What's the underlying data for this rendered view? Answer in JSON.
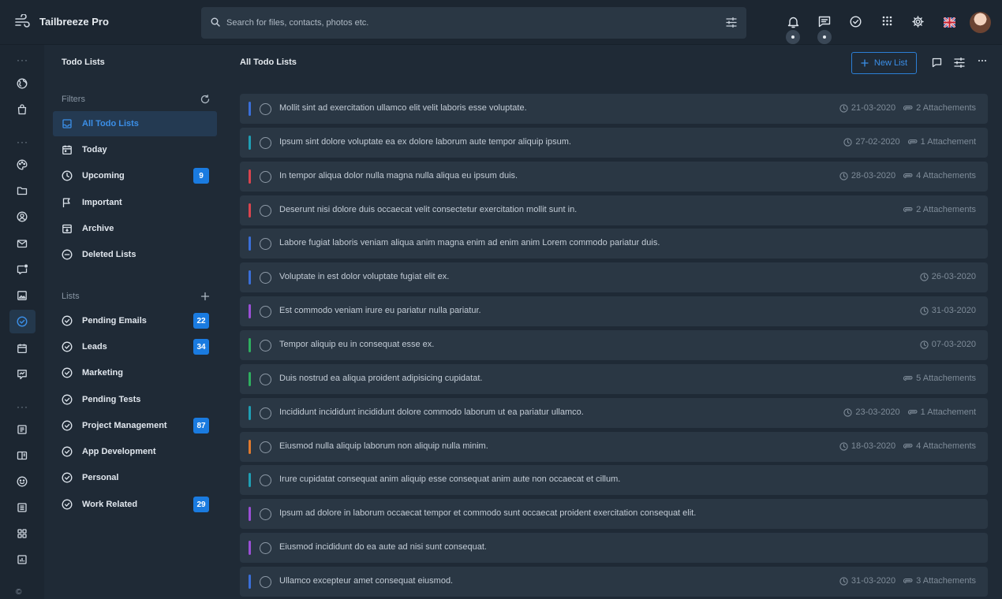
{
  "app": {
    "name": "Tailbreeze Pro"
  },
  "search": {
    "placeholder": "Search for files, contacts, photos etc."
  },
  "sidebar": {
    "title": "Todo Lists",
    "filters_label": "Filters",
    "lists_label": "Lists",
    "filters": [
      {
        "label": "All Todo Lists",
        "icon": "inbox-icon",
        "active": true
      },
      {
        "label": "Today",
        "icon": "calendar-today-icon"
      },
      {
        "label": "Upcoming",
        "icon": "clock-icon",
        "badge": "9"
      },
      {
        "label": "Important",
        "icon": "flag-icon"
      },
      {
        "label": "Archive",
        "icon": "archive-icon"
      },
      {
        "label": "Deleted Lists",
        "icon": "minus-circle-icon"
      }
    ],
    "lists": [
      {
        "label": "Pending Emails",
        "badge": "22"
      },
      {
        "label": "Leads",
        "badge": "34"
      },
      {
        "label": "Marketing"
      },
      {
        "label": "Pending Tests"
      },
      {
        "label": "Project Management",
        "badge": "87"
      },
      {
        "label": "App Development"
      },
      {
        "label": "Personal"
      },
      {
        "label": "Work Related",
        "badge": "29"
      }
    ]
  },
  "main": {
    "title": "All Todo Lists",
    "new_list_label": "New List"
  },
  "rail": {
    "copyright": "©"
  },
  "colors": {
    "accent": "#1a7be0",
    "blue": "#3a6fd8",
    "teal": "#1f9fb4",
    "red": "#d9444e",
    "purple": "#9b4fd6",
    "green": "#2fae5f",
    "orange": "#e07a2e"
  },
  "todos": [
    {
      "text": "Mollit sint ad exercitation ullamco elit velit laboris esse voluptate.",
      "color": "blue",
      "date": "21-03-2020",
      "attachments": "2 Attachements"
    },
    {
      "text": "Ipsum sint dolore voluptate ea ex dolore laborum aute tempor aliquip ipsum.",
      "color": "teal",
      "date": "27-02-2020",
      "attachments": "1 Attachement"
    },
    {
      "text": "In tempor aliqua dolor nulla magna nulla aliqua eu ipsum duis.",
      "color": "red",
      "date": "28-03-2020",
      "attachments": "4 Attachements"
    },
    {
      "text": "Deserunt nisi dolore duis occaecat velit consectetur exercitation mollit sunt in.",
      "color": "red",
      "attachments": "2 Attachements"
    },
    {
      "text": "Labore fugiat laboris veniam aliqua anim magna enim ad enim anim Lorem commodo pariatur duis.",
      "color": "blue"
    },
    {
      "text": "Voluptate in est dolor voluptate fugiat elit ex.",
      "color": "blue",
      "date": "26-03-2020"
    },
    {
      "text": "Est commodo veniam irure eu pariatur nulla pariatur.",
      "color": "purple",
      "date": "31-03-2020"
    },
    {
      "text": "Tempor aliquip eu in consequat esse ex.",
      "color": "green",
      "date": "07-03-2020"
    },
    {
      "text": "Duis nostrud ea aliqua proident adipisicing cupidatat.",
      "color": "green",
      "attachments": "5 Attachements"
    },
    {
      "text": "Incididunt incididunt incididunt dolore commodo laborum ut ea pariatur ullamco.",
      "color": "teal",
      "date": "23-03-2020",
      "attachments": "1 Attachement"
    },
    {
      "text": "Eiusmod nulla aliquip laborum non aliquip nulla minim.",
      "color": "orange",
      "date": "18-03-2020",
      "attachments": "4 Attachements"
    },
    {
      "text": "Irure cupidatat consequat anim aliquip esse consequat anim aute non occaecat et cillum.",
      "color": "teal"
    },
    {
      "text": "Ipsum ad dolore in laborum occaecat tempor et commodo sunt occaecat proident exercitation consequat elit.",
      "color": "purple"
    },
    {
      "text": "Eiusmod incididunt do ea aute ad nisi sunt consequat.",
      "color": "purple"
    },
    {
      "text": "Ullamco excepteur amet consequat eiusmod.",
      "color": "blue",
      "date": "31-03-2020",
      "attachments": "3 Attachements"
    }
  ]
}
